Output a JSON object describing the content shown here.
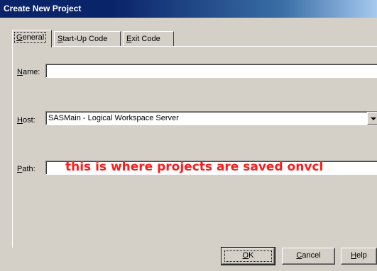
{
  "window": {
    "title": "Create New Project"
  },
  "tabs": [
    {
      "label": "General",
      "active": true
    },
    {
      "label": "Start-Up Code",
      "active": false
    },
    {
      "label": "Exit Code",
      "active": false
    }
  ],
  "form": {
    "name": {
      "label": "Name:",
      "value": ""
    },
    "host": {
      "label": "Host:",
      "value": "SASMain - Logical Workspace Server"
    },
    "path": {
      "label": "Path:",
      "value": ""
    }
  },
  "annotation": {
    "text": "this is where projects are saved onvcl",
    "color": "#ff1a1a"
  },
  "buttons": {
    "ok": "OK",
    "cancel": "Cancel",
    "help": "Help"
  },
  "colors": {
    "title_bar": "#0a246a",
    "dialog_face": "#d4d0c8"
  }
}
